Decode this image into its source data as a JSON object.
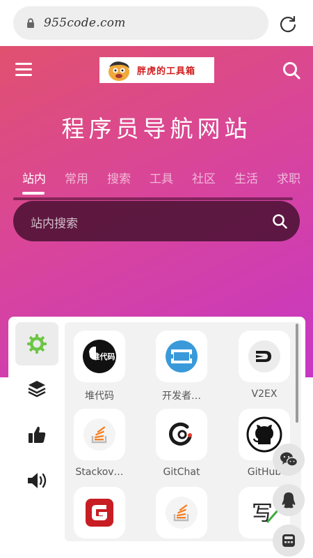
{
  "browser": {
    "url": "955code.com"
  },
  "header": {
    "logo_text": "胖虎的工具箱",
    "title": "程序员导航网站"
  },
  "tabs": [
    {
      "label": "站内"
    },
    {
      "label": "常用"
    },
    {
      "label": "搜索"
    },
    {
      "label": "工具"
    },
    {
      "label": "社区"
    },
    {
      "label": "生活"
    },
    {
      "label": "求职"
    }
  ],
  "search": {
    "placeholder": "站内搜索"
  },
  "side_nav": [
    {
      "icon": "gear-icon"
    },
    {
      "icon": "layers-icon"
    },
    {
      "icon": "thumbs-up-icon"
    },
    {
      "icon": "speaker-icon"
    }
  ],
  "tiles": [
    {
      "label": "堆代码",
      "icon": "duidaima-logo-icon",
      "logo_text": "堆代码"
    },
    {
      "label": "开发者…",
      "icon": "developer-logo-icon"
    },
    {
      "label": "V2EX",
      "icon": "v2ex-logo-icon"
    },
    {
      "label": "Stackov…",
      "icon": "stackoverflow-logo-icon"
    },
    {
      "label": "GitChat",
      "icon": "gitchat-logo-icon"
    },
    {
      "label": "GitHub",
      "icon": "github-logo-icon"
    },
    {
      "label": "",
      "icon": "gitee-logo-icon"
    },
    {
      "label": "",
      "icon": "stackoverflow-logo-icon"
    },
    {
      "label": "",
      "icon": "xie-logo-icon",
      "logo_text": "写"
    }
  ],
  "floating": [
    {
      "icon": "wechat-icon"
    },
    {
      "icon": "qq-icon"
    },
    {
      "icon": "calculator-icon"
    }
  ],
  "colors": {
    "hero_start": "#e0516f",
    "hero_end": "#c737c4",
    "active_gear": "#6cc644",
    "brand_red": "#d01c1c"
  }
}
